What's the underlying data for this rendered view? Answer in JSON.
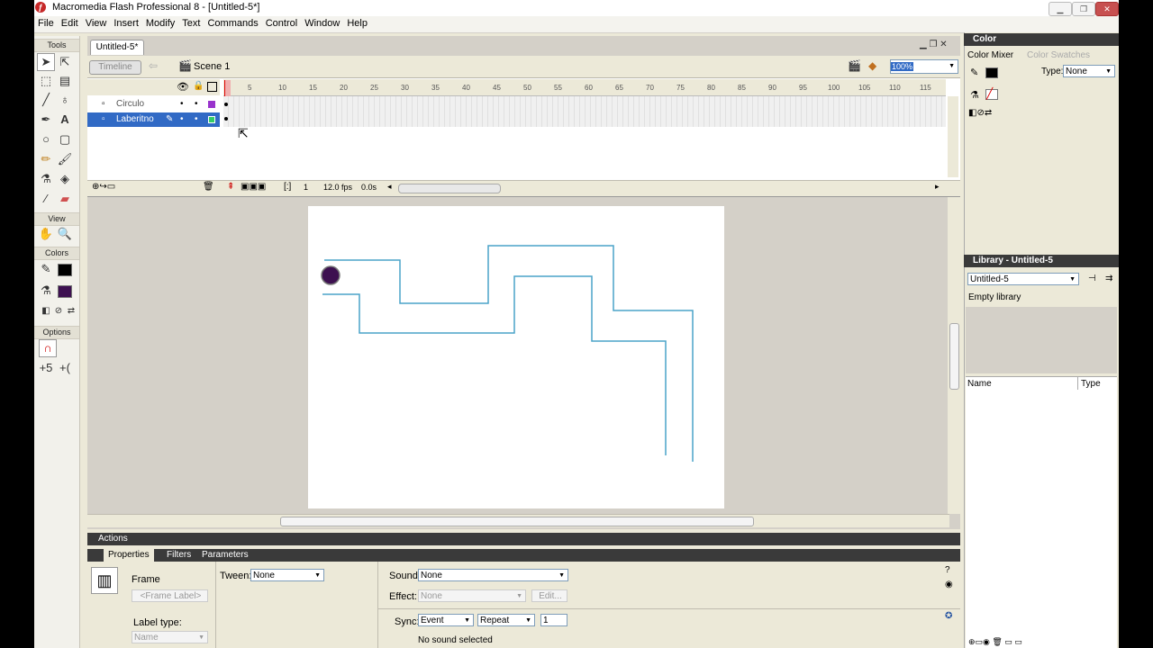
{
  "window": {
    "title": "Macromedia Flash Professional 8 - [Untitled-5*]",
    "buttons": [
      "minimize",
      "restore",
      "close"
    ]
  },
  "menu": [
    "File",
    "Edit",
    "View",
    "Insert",
    "Modify",
    "Text",
    "Commands",
    "Control",
    "Window",
    "Help"
  ],
  "tools": {
    "section_tools": "Tools",
    "section_view": "View",
    "section_colors": "Colors",
    "section_options": "Options"
  },
  "document": {
    "tab": "Untitled-5*",
    "timeline_button": "Timeline",
    "scene": "Scene 1",
    "zoom": "100%"
  },
  "timeline": {
    "ruler_labels": [
      "5",
      "10",
      "15",
      "20",
      "25",
      "30",
      "35",
      "40",
      "45",
      "50",
      "55",
      "60",
      "65",
      "70",
      "75",
      "80",
      "85",
      "90",
      "95",
      "100",
      "105",
      "110",
      "115"
    ],
    "layers": [
      {
        "name": "Circulo",
        "color": "#9933cc",
        "selected": false
      },
      {
        "name": "Laberitno",
        "color": "#33cc66",
        "selected": true
      }
    ],
    "current_frame": "1",
    "fps": "12.0 fps",
    "elapsed": "0.0s"
  },
  "stage": {
    "maze_color": "#4aa3c8",
    "ball_color": "#3d1050"
  },
  "panels": {
    "actions": "Actions",
    "properties_tab": "Properties",
    "filters_tab": "Filters",
    "parameters_tab": "Parameters"
  },
  "properties": {
    "type_label": "Frame",
    "frame_label_placeholder": "<Frame Label>",
    "label_type_caption": "Label type:",
    "label_type_value": "Name",
    "tween_caption": "Tween:",
    "tween_value": "None",
    "sound_caption": "Sound:",
    "sound_value": "None",
    "effect_caption": "Effect:",
    "effect_value": "None",
    "edit_button": "Edit...",
    "sync_caption": "Sync:",
    "sync_value": "Event",
    "repeat_value": "Repeat",
    "repeat_count": "1",
    "sound_status": "No sound selected"
  },
  "color_panel": {
    "title": "Color",
    "tab_mixer": "Color Mixer",
    "tab_swatches": "Color Swatches",
    "type_caption": "Type:",
    "type_value": "None"
  },
  "library_panel": {
    "title": "Library - Untitled-5",
    "document_select": "Untitled-5",
    "status": "Empty library",
    "col_name": "Name",
    "col_type": "Type"
  }
}
